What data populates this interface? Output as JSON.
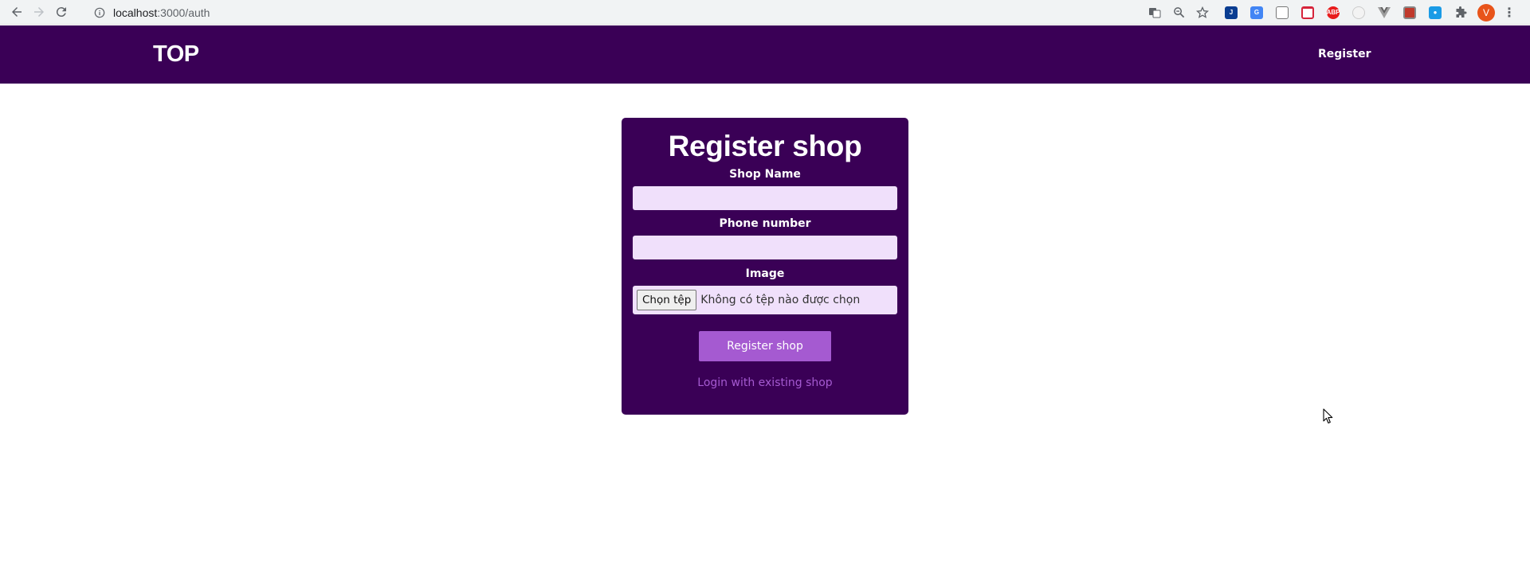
{
  "browser": {
    "url_host": "localhost",
    "url_path": ":3000/auth",
    "avatar_letter": "V",
    "extensions": [
      "translate-icon",
      "zoom-icon",
      "star-icon",
      "jira-icon",
      "google-translate-icon",
      "gallery-icon",
      "pocket-icon",
      "adblock-plus-icon",
      "clock-icon",
      "vue-icon",
      "react-icon",
      "dropper-icon",
      "puzzle-icon"
    ],
    "adblock_label": "ABP"
  },
  "navbar": {
    "brand": "TOP",
    "register_link": "Register",
    "background": "#3a0056"
  },
  "form": {
    "title": "Register shop",
    "shop_name_label": "Shop Name",
    "shop_name_value": "",
    "phone_label": "Phone number",
    "phone_value": "",
    "image_label": "Image",
    "file_button": "Chọn tệp",
    "file_status": "Không có tệp nào được chọn",
    "submit_label": "Register shop",
    "switch_link": "Login with existing shop",
    "accent_color": "#a55ad1",
    "input_color": "#f0e0fb"
  }
}
